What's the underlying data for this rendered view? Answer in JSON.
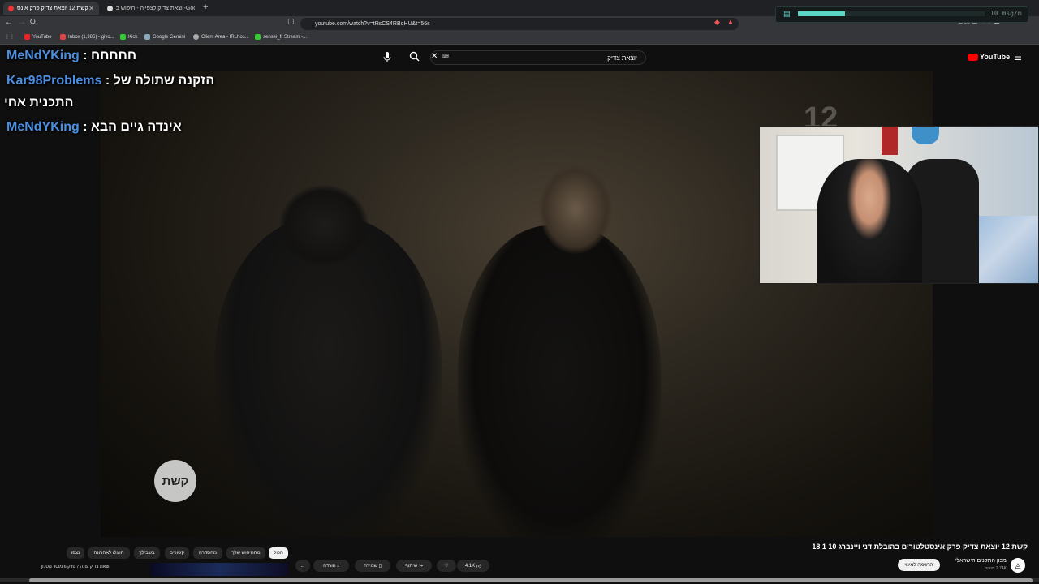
{
  "browser": {
    "tabs": [
      {
        "label": "קשת 12 יוצאת צדיק פרק אינס",
        "active": true
      },
      {
        "label": "יוצאת צדיק לצפייה - חיפוש ב-Google",
        "active": false
      }
    ],
    "url": "youtube.com/watch?v=tRsCS4RBqHU&t=56s",
    "bookmarks": [
      "YouTube",
      "Inbox (1,986) - givo...",
      "Kick",
      "Google Gemini",
      "Client Area - IRLhos...",
      "sensei_fr Stream -..."
    ]
  },
  "stream_widget": {
    "rate_label": "10 msg/m",
    "fill_fraction": 0.25
  },
  "youtube": {
    "logo_text": "YouTube",
    "search_value": "יוצאת צדיק"
  },
  "chat": [
    {
      "user": "MeNdYKing",
      "message": "חחחחח"
    },
    {
      "user": "Kar98Problems",
      "message": "הזקנה שתולה של",
      "continuation": "התכנית אחי"
    },
    {
      "user": "MeNdYKing",
      "message": "אינדה גיים הבא"
    }
  ],
  "video_overlay": {
    "watermark": "קשת",
    "channel_number": "12"
  },
  "video_info": {
    "title": "קשת 12 יוצאת צדיק פרק אינסטלטורים בהובלת דני ויינברג 10 1 18",
    "channel_name": "מכון התקנים הישראלי",
    "subscribers": "2.74K מנויים",
    "subscribe_label": "הרשמה למינוי",
    "like_count": "4.1K",
    "share_label": "שיתוף",
    "save_label": "שמירה",
    "download_label": "הורדה",
    "more_label": "..."
  },
  "chips": [
    "הכול",
    "מהחיפוש שלך",
    "מהסדרה",
    "קשורים",
    "בשבילך",
    "הועלו לאחרונה",
    "נצפו"
  ],
  "related": {
    "title": "יוצאת צדיק עונה 7 פרק 6 מוטר מסלון"
  }
}
